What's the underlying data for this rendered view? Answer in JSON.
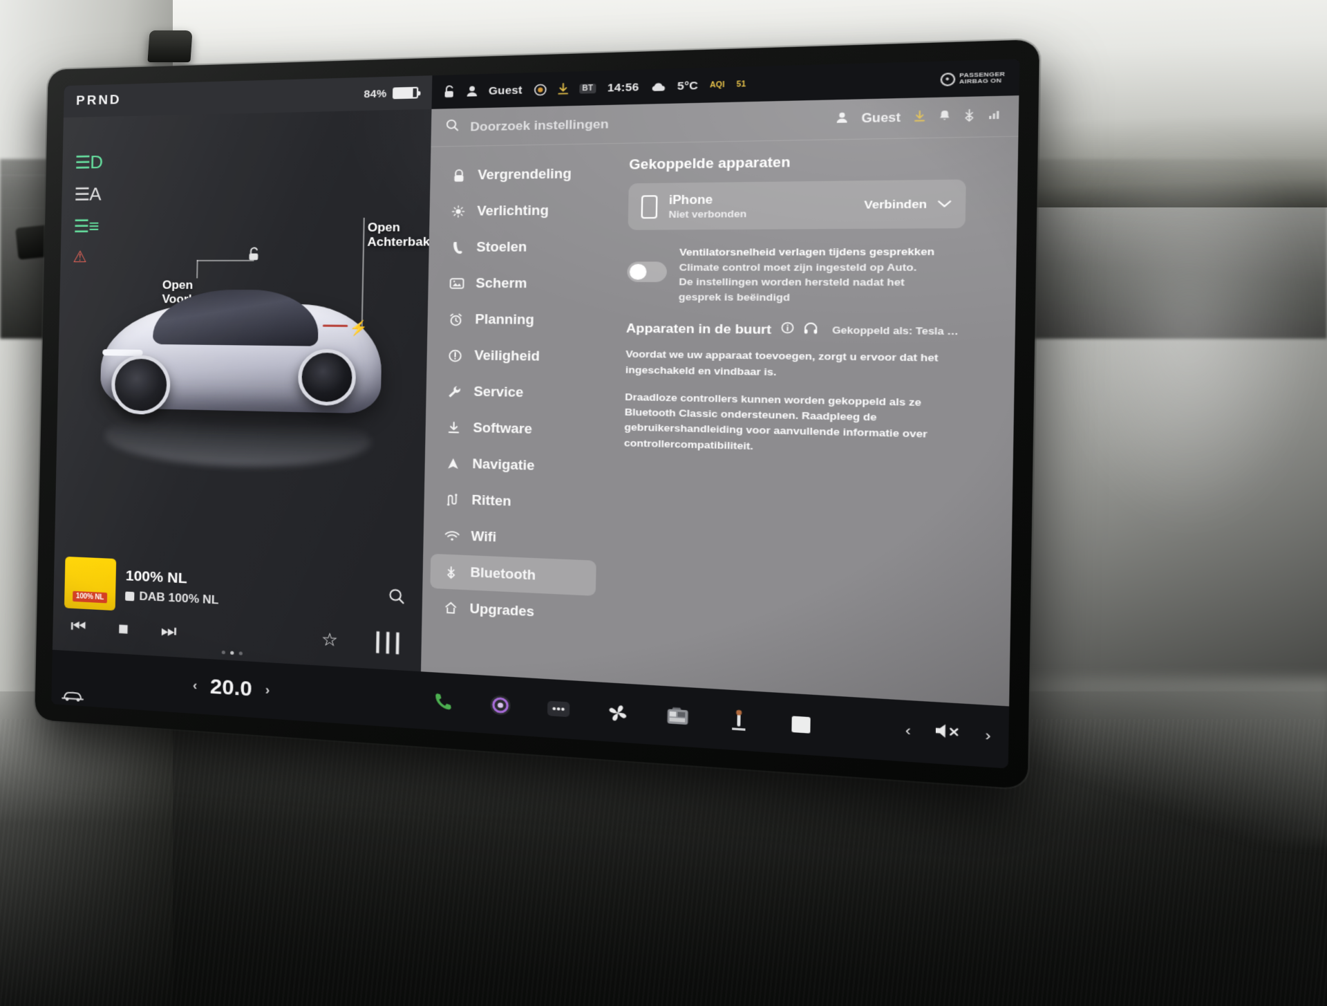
{
  "statusbar": {
    "brand": "PRND",
    "battery_percent": "84%",
    "lock_icon": "unlocked-icon",
    "profile_icon": "person-icon",
    "profile_name": "Guest",
    "record_icon": "dashcam-icon",
    "download_icon": "download-icon",
    "bluetooth_chip": "BT",
    "time": "14:56",
    "weather_icon": "cloud-icon",
    "temperature": "5°C",
    "aqi_label": "AQI",
    "aqi_value": "51",
    "passenger_airbag_line1": "PASSENGER",
    "passenger_airbag_line2": "AIRBAG ON"
  },
  "car_view": {
    "telltales": [
      {
        "name": "low-beam-icon",
        "glyph": "☰D",
        "color": "green"
      },
      {
        "name": "auto-high-beam-icon",
        "glyph": "☰A",
        "color": "white"
      },
      {
        "name": "fog-light-icon",
        "glyph": "☰≡",
        "color": "green"
      },
      {
        "name": "seatbelt-warning-icon",
        "glyph": "⚠",
        "color": "red"
      }
    ],
    "callout_front": "Open\nVoorbak",
    "callout_front_l1": "Open",
    "callout_front_l2": "Voorbak",
    "callout_rear_l1": "Open",
    "callout_rear_l2": "Achterbak",
    "lock_glyph": "unlocked-icon",
    "charge_glyph": "charge-bolt-icon"
  },
  "media": {
    "album_tag": "100% NL",
    "title": "100% NL",
    "subtitle": "DAB 100% NL",
    "controls": [
      {
        "name": "previous-track-button",
        "glyph": "⏮"
      },
      {
        "name": "stop-button",
        "glyph": "■"
      },
      {
        "name": "next-track-button",
        "glyph": "⏭"
      },
      {
        "name": "favorite-button",
        "glyph": "☆"
      },
      {
        "name": "equalizer-button",
        "glyph": "⦀"
      }
    ],
    "search_icon": "search-icon",
    "page_dots": 3,
    "active_dot": 1
  },
  "settings": {
    "search_placeholder": "Doorzoek instellingen",
    "search_icon": "search-icon",
    "account_name": "Guest",
    "header_icons": [
      "person-icon",
      "download-icon",
      "bell-icon",
      "bluetooth-icon",
      "signal-icon"
    ],
    "nav": [
      {
        "label": "Vergrendeling",
        "icon": "lock-icon",
        "glyph": "🔒",
        "active": false
      },
      {
        "label": "Verlichting",
        "icon": "brightness-icon",
        "glyph": "☀",
        "active": false
      },
      {
        "label": "Stoelen",
        "icon": "seat-icon",
        "glyph": "☎",
        "active": false
      },
      {
        "label": "Scherm",
        "icon": "display-icon",
        "glyph": "⌸",
        "active": false
      },
      {
        "label": "Planning",
        "icon": "alarm-clock-icon",
        "glyph": "⏰",
        "active": false
      },
      {
        "label": "Veiligheid",
        "icon": "safety-icon",
        "glyph": "ⓘ",
        "active": false
      },
      {
        "label": "Service",
        "icon": "wrench-icon",
        "glyph": "🔧",
        "active": false
      },
      {
        "label": "Software",
        "icon": "download-icon",
        "glyph": "⤓",
        "active": false
      },
      {
        "label": "Navigatie",
        "icon": "navigation-arrow-icon",
        "glyph": "▲",
        "active": false
      },
      {
        "label": "Ritten",
        "icon": "trips-icon",
        "glyph": "⥯",
        "active": false
      },
      {
        "label": "Wifi",
        "icon": "wifi-icon",
        "glyph": "◠",
        "active": false
      },
      {
        "label": "Bluetooth",
        "icon": "bluetooth-icon",
        "glyph": "ᛦ",
        "active": true
      },
      {
        "label": "Upgrades",
        "icon": "upgrades-icon",
        "glyph": "⌂",
        "active": false
      }
    ],
    "paired": {
      "section_title": "Gekoppelde apparaten",
      "device_icon": "phone-icon",
      "device_name": "iPhone",
      "device_status": "Niet verbonden",
      "action_label": "Verbinden",
      "chevron": "chevron-down-icon"
    },
    "fan_toggle": {
      "state": "off",
      "title": "Ventilatorsnelheid verlagen tijdens gesprekken",
      "desc_line1": "Climate control moet zijn ingesteld op Auto.",
      "desc_line2": "De instellingen worden hersteld nadat het",
      "desc_line3": "gesprek is beëindigd"
    },
    "nearby": {
      "title": "Apparaten in de buurt",
      "info_icon": "info-icon",
      "headphone_icon": "headphones-icon",
      "paired_as": "Gekoppeld als: Tesla …",
      "paragraph1": "Voordat we uw apparaat toevoegen, zorgt u ervoor dat het ingeschakeld en vindbaar is.",
      "paragraph2": "Draadloze controllers kunnen worden gekoppeld als ze Bluetooth Classic ondersteunen. Raadpleeg de gebruikershandleiding voor aanvullende informatie over controllercompatibiliteit."
    }
  },
  "taskbar": {
    "car_icon": "car-icon",
    "temp_value": "20.0",
    "temp_left_arrow": "‹",
    "temp_right_arrow": "›",
    "icons": [
      {
        "name": "phone-icon",
        "glyph": "☎"
      },
      {
        "name": "voice-assistant-icon",
        "glyph": "◉"
      },
      {
        "name": "apps-icon",
        "glyph": "⋯"
      },
      {
        "name": "fan-icon",
        "glyph": "❁"
      },
      {
        "name": "camera-icon",
        "glyph": "☷"
      },
      {
        "name": "seat-heater-icon",
        "glyph": "⚑"
      },
      {
        "name": "window-icon",
        "glyph": "□"
      }
    ],
    "volume_prev": "‹",
    "volume_mute_icon": "volume-mute-icon",
    "volume_next": "›"
  },
  "colors": {
    "accent_green": "#5ae39a",
    "accent_yellow": "#ffd400",
    "settings_bg": "#8d8c8f",
    "panel_bg": "#232428",
    "taskbar_bg": "#121316"
  }
}
